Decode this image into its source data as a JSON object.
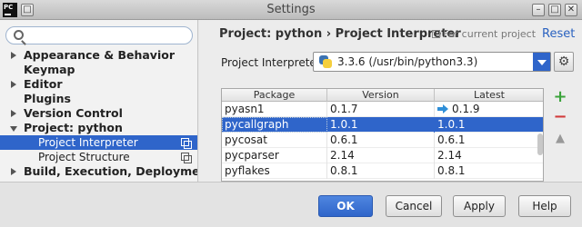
{
  "window": {
    "title": "Settings",
    "app_icon": "PC",
    "controls": {
      "minimize": "–",
      "maximize": "□",
      "close": "✕"
    }
  },
  "sidebar": {
    "search": {
      "value": "",
      "placeholder": ""
    },
    "items": [
      {
        "label": "Appearance & Behavior",
        "expandable": true
      },
      {
        "label": "Keymap",
        "expandable": false
      },
      {
        "label": "Editor",
        "expandable": true
      },
      {
        "label": "Plugins",
        "expandable": false
      },
      {
        "label": "Version Control",
        "expandable": true
      },
      {
        "label": "Project: python",
        "expanded": true
      },
      {
        "label": "Project Interpreter",
        "child": true,
        "selected": true
      },
      {
        "label": "Project Structure",
        "child": true
      },
      {
        "label": "Build, Execution, Deployment",
        "expandable": true
      }
    ]
  },
  "main": {
    "breadcrumb": "Project: python › Project Interpreter",
    "for_current_project": "For current project",
    "reset": "Reset",
    "interpreter_label": "Project Interpreter:",
    "interpreter_value": "3.3.6 (/usr/bin/python3.3)",
    "gear": "⚙",
    "table": {
      "columns": [
        "Package",
        "Version",
        "Latest"
      ],
      "rows": [
        {
          "package": "pyasn1",
          "version": "0.1.7",
          "latest": "0.1.9",
          "upgrade": true
        },
        {
          "package": "pycallgraph",
          "version": "1.0.1",
          "latest": "1.0.1",
          "selected": true
        },
        {
          "package": "pycosat",
          "version": "0.6.1",
          "latest": "0.6.1"
        },
        {
          "package": "pycparser",
          "version": "2.14",
          "latest": "2.14"
        },
        {
          "package": "pyflakes",
          "version": "0.8.1",
          "latest": "0.8.1"
        }
      ]
    },
    "tools": {
      "add": "+",
      "remove": "−",
      "upgrade": "▲"
    }
  },
  "footer": {
    "ok": "OK",
    "cancel": "Cancel",
    "apply": "Apply",
    "help": "Help"
  },
  "colors": {
    "accent": "#2f65ca",
    "add": "#3aa33a",
    "remove": "#d23a3a",
    "link": "#2a62c0"
  }
}
